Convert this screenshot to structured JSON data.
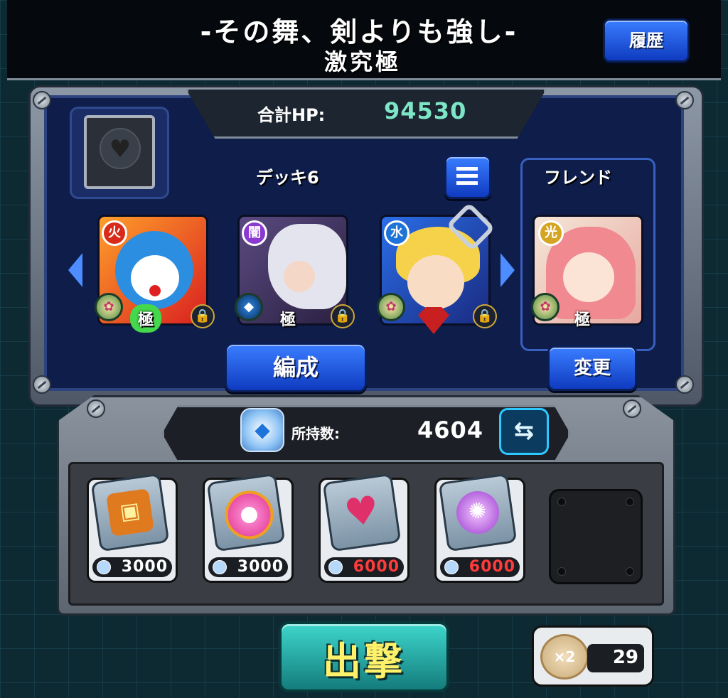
{
  "header": {
    "title": "-その舞、剣よりも強し-",
    "subtitle": "激究極",
    "history_label": "履歴"
  },
  "party": {
    "total_hp_label": "合計HP:",
    "total_hp_value": "94530",
    "deck_label": "デッキ6",
    "friend_label": "フレンド",
    "edit_label": "編成",
    "change_label": "変更",
    "goku_badge": "極",
    "characters": [
      {
        "element": "fire",
        "color": "#d92b1a",
        "element_glyph": "火"
      },
      {
        "element": "dark",
        "color": "#8a3ad0",
        "element_glyph": "闇"
      },
      {
        "element": "water",
        "color": "#1e74d8",
        "element_glyph": "水"
      },
      {
        "element": "light",
        "color": "#d4a423",
        "element_glyph": "光"
      }
    ]
  },
  "items": {
    "owned_label": "所持数:",
    "owned_value": "4604",
    "list": [
      {
        "name": "treasure-chest",
        "price": "3000",
        "price_color": "#ffffff"
      },
      {
        "name": "speed-orb",
        "price": "3000",
        "price_color": "#ffffff"
      },
      {
        "name": "heart-plus",
        "price": "6000",
        "price_color": "#ff3b3b"
      },
      {
        "name": "purple-burst",
        "price": "6000",
        "price_color": "#ff3b3b"
      }
    ]
  },
  "bottom": {
    "sortie_label": "出撃",
    "boost_multiplier": "×2",
    "boost_count": "29"
  }
}
